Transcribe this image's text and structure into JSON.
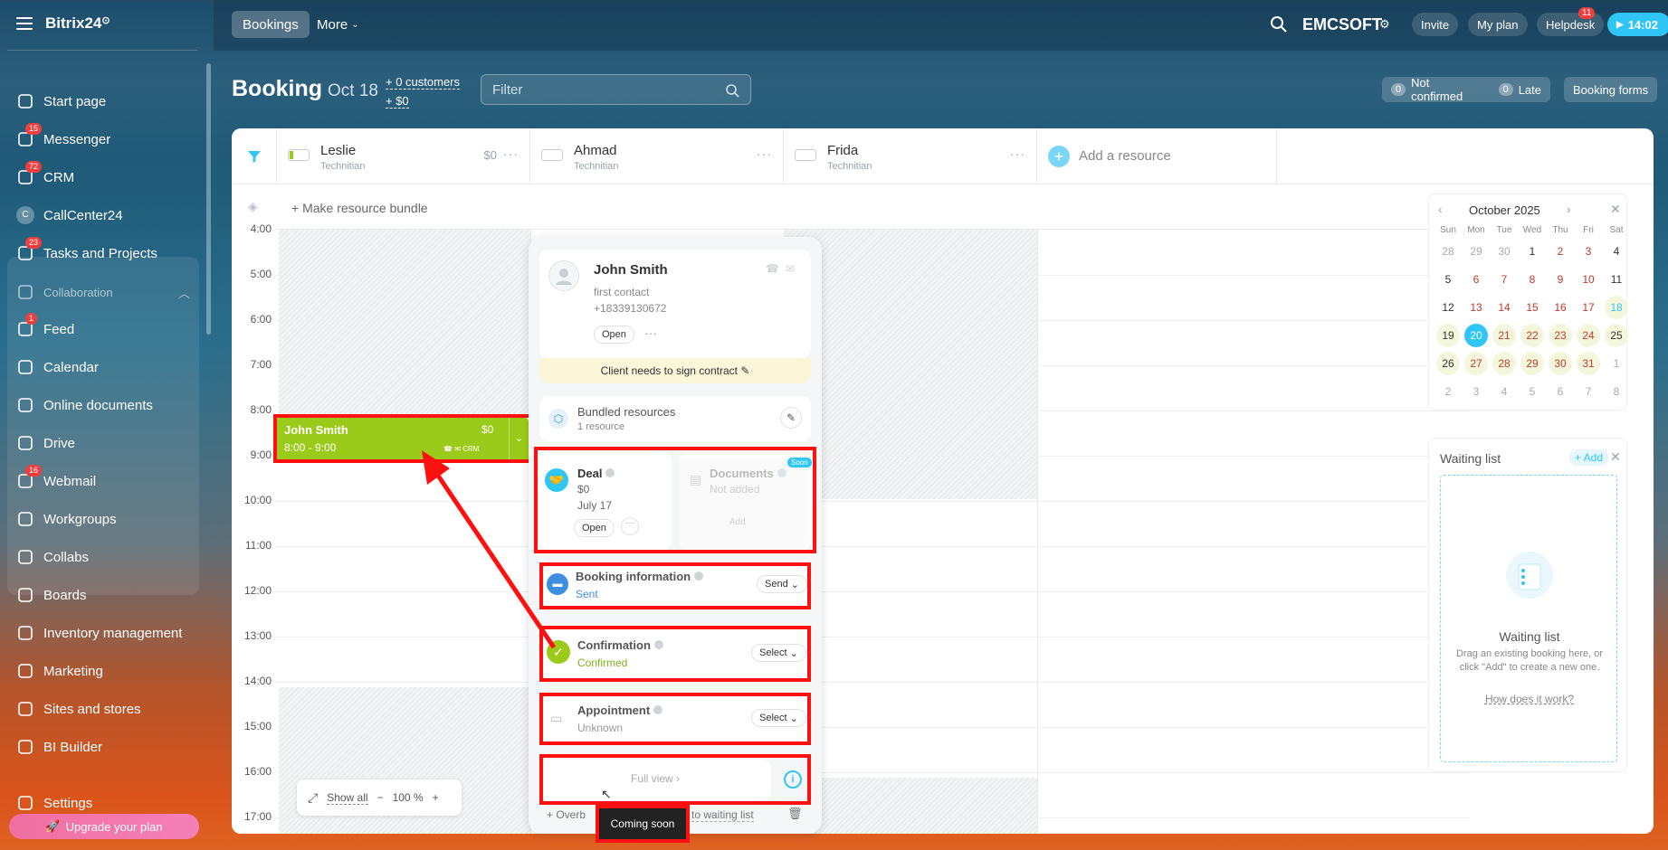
{
  "app": {
    "logo": "Bitrix24",
    "logo_mark": "⊙"
  },
  "sidebar": {
    "items": [
      {
        "label": "Start page",
        "icon": "home-icon"
      },
      {
        "label": "Messenger",
        "icon": "chat-icon",
        "badge": "15"
      },
      {
        "label": "CRM",
        "icon": "crm-icon",
        "badge": "72"
      },
      {
        "label": "CallCenter24",
        "icon": "callcenter-icon",
        "avatar": "C"
      },
      {
        "label": "Tasks and Projects",
        "icon": "tasks-icon",
        "badge": "23"
      },
      {
        "label": "Collaboration",
        "icon": "collaboration-icon",
        "group": true
      },
      {
        "label": "Feed",
        "icon": "feed-icon",
        "badge": "1"
      },
      {
        "label": "Calendar",
        "icon": "calendar-icon"
      },
      {
        "label": "Online documents",
        "icon": "documents-icon"
      },
      {
        "label": "Drive",
        "icon": "drive-icon"
      },
      {
        "label": "Webmail",
        "icon": "mail-icon",
        "badge": "16"
      },
      {
        "label": "Workgroups",
        "icon": "workgroups-icon"
      },
      {
        "label": "Collabs",
        "icon": "collabs-icon"
      },
      {
        "label": "Boards",
        "icon": "boards-icon"
      },
      {
        "label": "Inventory management",
        "icon": "inventory-icon"
      },
      {
        "label": "Marketing",
        "icon": "marketing-icon"
      },
      {
        "label": "Sites and stores",
        "icon": "cart-icon"
      },
      {
        "label": "BI Builder",
        "icon": "bi-icon"
      },
      {
        "label": "Settings",
        "icon": "gear-icon"
      }
    ],
    "upgrade": "Upgrade your plan"
  },
  "topbar": {
    "bookings": "Bookings",
    "more": "More",
    "company": "EMCSOFT",
    "invite": "Invite",
    "myplan": "My plan",
    "helpdesk": "Helpdesk",
    "helpdesk_badge": "11",
    "time": "14:02"
  },
  "header": {
    "title": "Booking",
    "date": "Oct 18",
    "customers": "+ 0 customers",
    "amount": "+ $0",
    "filter_placeholder": "Filter",
    "not_confirmed_count": "0",
    "not_confirmed": "Not confirmed",
    "late_count": "0",
    "late": "Late",
    "booking_forms": "Booking forms"
  },
  "resources": [
    {
      "name": "Leslie",
      "role": "Technitian",
      "amount": "$0"
    },
    {
      "name": "Ahmad",
      "role": "Technitian",
      "amount": ""
    },
    {
      "name": "Frida",
      "role": "Technitian",
      "amount": ""
    }
  ],
  "add_resource": "Add a resource",
  "make_bundle": "+ Make resource bundle",
  "hours": [
    "4:00",
    "5:00",
    "6:00",
    "7:00",
    "8:00",
    "9:00",
    "10:00",
    "11:00",
    "12:00",
    "13:00",
    "14:00",
    "15:00",
    "16:00",
    "17:00"
  ],
  "booking": {
    "name": "John Smith",
    "amount": "$0",
    "time": "8:00 - 9:00",
    "crm": "CRM"
  },
  "zoom": {
    "show_all": "Show all",
    "minus": "−",
    "value": "100 %",
    "plus": "+"
  },
  "popup": {
    "client_name": "John Smith",
    "client_type": "first contact",
    "client_phone": "+18339130672",
    "open": "Open",
    "note": "Client needs to sign contract",
    "bundled_title": "Bundled resources",
    "bundled_count": "1 resource",
    "deal_title": "Deal",
    "deal_amount": "$0",
    "deal_date": "July 17",
    "deal_open": "Open",
    "docs_title": "Documents",
    "docs_status": "Not added",
    "docs_add": "Add",
    "soon": "Soon",
    "info_title": "Booking information",
    "info_status": "Sent",
    "info_btn": "Send",
    "confirm_title": "Confirmation",
    "confirm_status": "Confirmed",
    "confirm_btn": "Select",
    "appt_title": "Appointment",
    "appt_status": "Unknown",
    "appt_btn": "Select",
    "full_view": "Full view",
    "overbook": "+ Overb",
    "waiting": "to waiting list",
    "tooltip": "Coming soon"
  },
  "calendar": {
    "month": "October 2025",
    "weekdays": [
      "Sun",
      "Mon",
      "Tue",
      "Wed",
      "Thu",
      "Fri",
      "Sat"
    ],
    "days": [
      "28",
      "29",
      "30",
      "1",
      "2",
      "3",
      "4",
      "5",
      "6",
      "7",
      "8",
      "9",
      "10",
      "11",
      "12",
      "13",
      "14",
      "15",
      "16",
      "17",
      "18",
      "19",
      "20",
      "21",
      "22",
      "23",
      "24",
      "25",
      "26",
      "27",
      "28",
      "29",
      "30",
      "31",
      "1",
      "2",
      "3",
      "4",
      "5",
      "6",
      "7",
      "8"
    ],
    "today": "20",
    "selected": "18"
  },
  "waiting": {
    "title": "Waiting list",
    "add": "+ Add",
    "empty_title": "Waiting list",
    "empty_text": "Drag an existing booking here, or click \"Add\" to create a new one.",
    "how": "How does it work?"
  },
  "colors": {
    "accent": "#2fc6f6",
    "booking": "#9bcb1a",
    "annotation": "#ff1010"
  }
}
